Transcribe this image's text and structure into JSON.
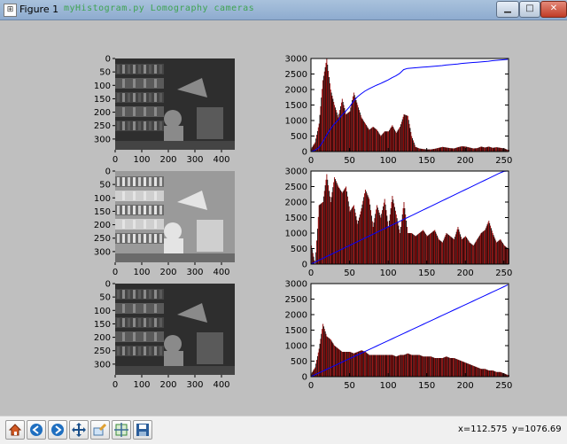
{
  "window": {
    "title": "Figure 1",
    "ghost_text": "myHistogram.py   Lomography cameras"
  },
  "status": {
    "x": "x=112.575",
    "y": "y=1076.69"
  },
  "toolbar": [
    "home-icon",
    "back-icon",
    "forward-icon",
    "pan-icon",
    "zoom-icon",
    "subplots-icon",
    "save-icon"
  ],
  "image_axes": {
    "xticks": [
      "0",
      "100",
      "200",
      "300",
      "400"
    ],
    "yticks": [
      "0",
      "50",
      "100",
      "150",
      "200",
      "250",
      "300"
    ]
  },
  "chart_data": [
    {
      "type": "bar",
      "x": [
        0,
        5,
        10,
        15,
        20,
        25,
        30,
        35,
        40,
        45,
        50,
        55,
        60,
        65,
        70,
        75,
        80,
        85,
        90,
        95,
        100,
        105,
        110,
        115,
        120,
        125,
        130,
        135,
        140,
        145,
        150,
        155,
        160,
        165,
        170,
        175,
        180,
        185,
        190,
        195,
        200,
        205,
        210,
        215,
        220,
        225,
        230,
        235,
        240,
        245,
        250,
        255
      ],
      "values": [
        100,
        300,
        900,
        2300,
        3000,
        2000,
        1500,
        1100,
        1700,
        1200,
        1300,
        1900,
        1500,
        1100,
        900,
        700,
        800,
        700,
        500,
        650,
        650,
        850,
        600,
        800,
        1200,
        1150,
        500,
        150,
        100,
        80,
        70,
        70,
        90,
        120,
        150,
        130,
        110,
        100,
        140,
        170,
        160,
        130,
        100,
        110,
        160,
        130,
        160,
        120,
        140,
        120,
        100,
        50
      ],
      "cdf": [
        0,
        40,
        120,
        300,
        520,
        720,
        880,
        1010,
        1170,
        1300,
        1440,
        1620,
        1760,
        1860,
        1950,
        2020,
        2080,
        2140,
        2190,
        2250,
        2310,
        2380,
        2440,
        2520,
        2640,
        2680,
        2690,
        2700,
        2710,
        2720,
        2730,
        2740,
        2750,
        2760,
        2770,
        2790,
        2800,
        2810,
        2820,
        2840,
        2850,
        2860,
        2870,
        2880,
        2890,
        2900,
        2910,
        2930,
        2940,
        2950,
        2960,
        2970
      ],
      "ylim": [
        0,
        3000
      ],
      "xlim": [
        0,
        256
      ],
      "yticks": [
        "0",
        "500",
        "1000",
        "1500",
        "2000",
        "2500",
        "3000"
      ],
      "xticks": [
        "0",
        "50",
        "100",
        "150",
        "200",
        "250"
      ]
    },
    {
      "type": "bar",
      "x": [
        0,
        5,
        10,
        15,
        20,
        25,
        30,
        35,
        40,
        45,
        50,
        55,
        60,
        65,
        70,
        75,
        80,
        85,
        90,
        95,
        100,
        105,
        110,
        115,
        120,
        125,
        130,
        135,
        140,
        145,
        150,
        155,
        160,
        165,
        170,
        175,
        180,
        185,
        190,
        195,
        200,
        205,
        210,
        215,
        220,
        225,
        230,
        235,
        240,
        245,
        250,
        255
      ],
      "values": [
        600,
        0,
        1900,
        2000,
        2900,
        2000,
        2800,
        2500,
        2300,
        2500,
        1700,
        1900,
        1300,
        1800,
        2400,
        2100,
        1200,
        1900,
        1500,
        2100,
        1200,
        2200,
        1600,
        1000,
        2000,
        1000,
        1000,
        900,
        1000,
        1100,
        900,
        1000,
        1100,
        800,
        700,
        1000,
        900,
        800,
        1200,
        800,
        900,
        700,
        600,
        800,
        1000,
        1100,
        1400,
        1000,
        700,
        800,
        600,
        500
      ],
      "cdf": [
        0,
        60,
        120,
        180,
        240,
        300,
        360,
        420,
        480,
        540,
        600,
        660,
        720,
        780,
        840,
        900,
        960,
        1020,
        1080,
        1140,
        1200,
        1260,
        1320,
        1380,
        1440,
        1500,
        1560,
        1620,
        1680,
        1740,
        1800,
        1860,
        1920,
        1980,
        2040,
        2100,
        2160,
        2220,
        2280,
        2340,
        2400,
        2460,
        2520,
        2580,
        2640,
        2700,
        2760,
        2820,
        2880,
        2940,
        2990,
        3000
      ],
      "ylim": [
        0,
        3000
      ],
      "xlim": [
        0,
        256
      ],
      "yticks": [
        "0",
        "500",
        "1000",
        "1500",
        "2000",
        "2500",
        "3000"
      ],
      "xticks": [
        "0",
        "50",
        "100",
        "150",
        "200",
        "250"
      ]
    },
    {
      "type": "bar",
      "x": [
        0,
        5,
        10,
        15,
        20,
        25,
        30,
        35,
        40,
        45,
        50,
        55,
        60,
        65,
        70,
        75,
        80,
        85,
        90,
        95,
        100,
        105,
        110,
        115,
        120,
        125,
        130,
        135,
        140,
        145,
        150,
        155,
        160,
        165,
        170,
        175,
        180,
        185,
        190,
        195,
        200,
        205,
        210,
        215,
        220,
        225,
        230,
        235,
        240,
        245,
        250,
        255
      ],
      "values": [
        100,
        300,
        900,
        1700,
        1300,
        1200,
        1000,
        900,
        800,
        800,
        800,
        750,
        800,
        850,
        800,
        700,
        700,
        700,
        700,
        700,
        700,
        700,
        650,
        700,
        700,
        750,
        700,
        700,
        700,
        650,
        650,
        650,
        600,
        600,
        600,
        650,
        600,
        600,
        550,
        500,
        450,
        400,
        350,
        300,
        250,
        250,
        200,
        200,
        150,
        150,
        100,
        50
      ],
      "cdf": [
        0,
        58,
        116,
        174,
        232,
        290,
        348,
        406,
        464,
        522,
        580,
        638,
        696,
        754,
        812,
        870,
        928,
        986,
        1044,
        1102,
        1160,
        1218,
        1276,
        1334,
        1392,
        1450,
        1508,
        1566,
        1624,
        1682,
        1740,
        1798,
        1856,
        1914,
        1972,
        2030,
        2088,
        2146,
        2204,
        2262,
        2320,
        2378,
        2436,
        2494,
        2552,
        2610,
        2668,
        2726,
        2784,
        2842,
        2900,
        2958
      ],
      "ylim": [
        0,
        3000
      ],
      "xlim": [
        0,
        256
      ],
      "yticks": [
        "0",
        "500",
        "1000",
        "1500",
        "2000",
        "2500",
        "3000"
      ],
      "xticks": [
        "0",
        "50",
        "100",
        "150",
        "200",
        "250"
      ]
    }
  ]
}
